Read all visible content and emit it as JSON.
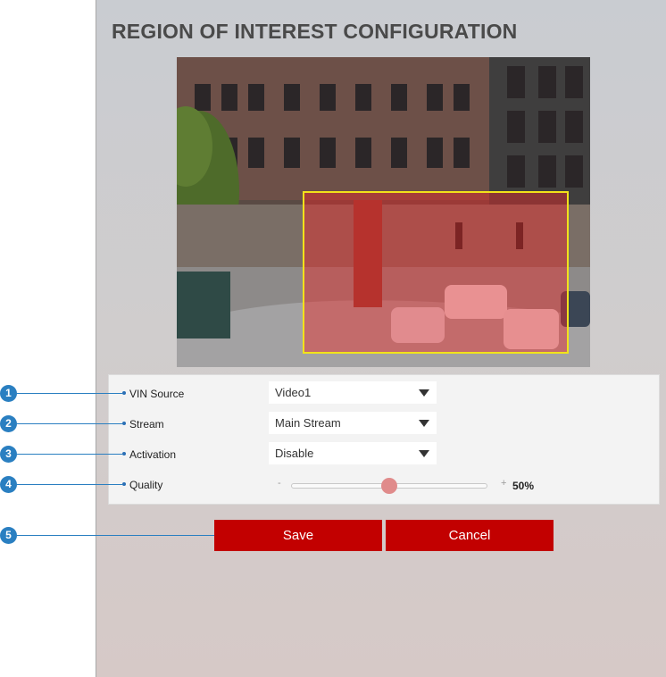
{
  "page_title": "REGION OF INTEREST CONFIGURATION",
  "callouts": [
    "1",
    "2",
    "3",
    "4",
    "5"
  ],
  "form": {
    "vin_source": {
      "label": "VIN Source",
      "value": "Video1"
    },
    "stream": {
      "label": "Stream",
      "value": "Main Stream"
    },
    "activation": {
      "label": "Activation",
      "value": "Disable"
    },
    "quality": {
      "label": "Quality",
      "minus": "-",
      "plus": "+",
      "value": "50%",
      "level_fraction": 0.5
    }
  },
  "buttons": {
    "save": "Save",
    "cancel": "Cancel"
  },
  "colors": {
    "accent": "#c20000",
    "roi_border": "#f2e21a",
    "callout": "#2a7fc1"
  }
}
